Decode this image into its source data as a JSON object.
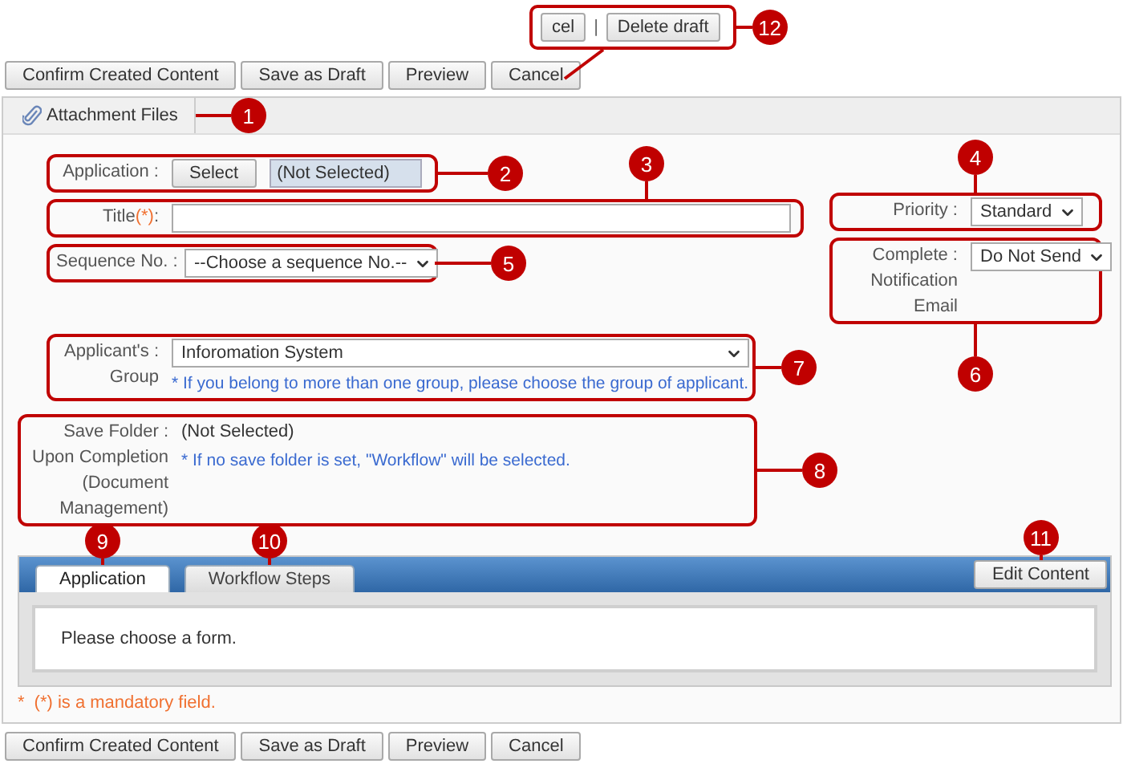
{
  "draft_popup": {
    "buttons": [
      "cel",
      "Delete draft"
    ],
    "separator": "|",
    "callout": "12"
  },
  "toolbar_top": [
    "Confirm Created Content",
    "Save as Draft",
    "Preview",
    "Cancel"
  ],
  "attachment_tab": {
    "label": "Attachment Files",
    "callout": "1"
  },
  "application": {
    "label": [
      "Application :"
    ],
    "button": "Select",
    "value": "(Not Selected)",
    "callout": "2"
  },
  "title": {
    "label": "Title",
    "required_mark": "(*)",
    "suffix": ":",
    "callout": "3"
  },
  "priority": {
    "label": [
      "Priority :"
    ],
    "value": "Standard",
    "callout": "4"
  },
  "sequence": {
    "label": [
      "Sequence No. :"
    ],
    "value": "--Choose a sequence No.--",
    "callout": "5"
  },
  "completion_email": {
    "label": [
      "Complete :",
      "Notification",
      "Email"
    ],
    "value": "Do Not Send",
    "callout": "6"
  },
  "group": {
    "label": [
      "Applicant's :",
      "Group"
    ],
    "value": "Inforomation System",
    "note": "* If you belong to more than one group, please choose the group of applicant.",
    "callout": "7"
  },
  "save_folder": {
    "label": [
      "Save Folder :",
      "Upon Completion",
      "(Document",
      "Management)"
    ],
    "value": "(Not Selected)",
    "note": "* If no save folder is set, \"Workflow\" will be selected.",
    "callout": "8"
  },
  "content_tabs": [
    {
      "label": "Application",
      "selected": true,
      "callout": "9"
    },
    {
      "label": "Workflow Steps",
      "selected": false,
      "callout": "10"
    }
  ],
  "edit_button": {
    "label": "Edit Content",
    "callout": "11"
  },
  "form_message": "Please choose a form.",
  "mandatory_note": {
    "star": "*",
    "text": "(*) is a mandatory field."
  },
  "toolbar_bottom": [
    "Confirm Created Content",
    "Save as Draft",
    "Preview",
    "Cancel"
  ]
}
